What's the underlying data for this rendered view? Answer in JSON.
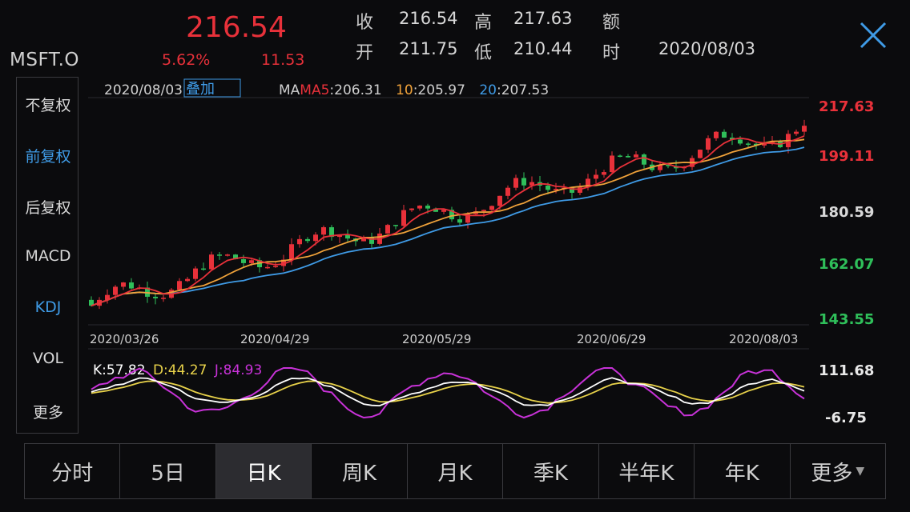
{
  "header": {
    "ticker": "MSFT.O",
    "price": "216.54",
    "change_pct": "5.62%",
    "change": "11.53",
    "quote": [
      {
        "label": "收",
        "value": "216.54"
      },
      {
        "label": "高",
        "value": "217.63"
      },
      {
        "label": "额",
        "value": ""
      },
      {
        "label": "开",
        "value": "211.75"
      },
      {
        "label": "低",
        "value": "210.44"
      },
      {
        "label": "时",
        "value": "2020/08/03"
      }
    ]
  },
  "left_menu": [
    {
      "label": "不复权",
      "active": false
    },
    {
      "label": "前复权",
      "active": true
    },
    {
      "label": "后复权",
      "active": false
    },
    {
      "label": "MACD",
      "active": false
    },
    {
      "label": "KDJ",
      "active": true
    },
    {
      "label": "VOL",
      "active": false
    },
    {
      "label": "更多",
      "active": false
    }
  ],
  "main_chart": {
    "date_label": "2020/08/03",
    "overlay_button": "叠加",
    "ma": [
      {
        "name": "MA5",
        "value": "206.31",
        "color": "#e8313a"
      },
      {
        "name": "10",
        "value": "205.97",
        "color": "#f0a23a"
      },
      {
        "name": "20",
        "value": "207.53",
        "color": "#3f9be6"
      }
    ],
    "y_labels": [
      {
        "text": "217.63",
        "color": "#e8313a"
      },
      {
        "text": "199.11",
        "color": "#e8313a"
      },
      {
        "text": "180.59",
        "color": "#d8d8d8"
      },
      {
        "text": "162.07",
        "color": "#2fbf5a"
      },
      {
        "text": "143.55",
        "color": "#2fbf5a"
      }
    ],
    "x_labels": [
      "2020/03/26",
      "2020/04/29",
      "2020/05/29",
      "2020/06/29",
      "2020/08/03"
    ]
  },
  "kdj": {
    "k_label": "K:57.82",
    "d_label": "D:44.27",
    "j_label": "J:84.93",
    "y_labels": [
      "111.68",
      "-6.75"
    ],
    "colors": {
      "k": "#ffffff",
      "d": "#e8d24a",
      "j": "#c832d8"
    }
  },
  "tabs": [
    {
      "label": "分时",
      "active": false
    },
    {
      "label": "5日",
      "active": false
    },
    {
      "label": "日K",
      "active": true
    },
    {
      "label": "周K",
      "active": false
    },
    {
      "label": "月K",
      "active": false
    },
    {
      "label": "季K",
      "active": false
    },
    {
      "label": "半年K",
      "active": false
    },
    {
      "label": "年K",
      "active": false
    },
    {
      "label": "更多",
      "active": false,
      "dropdown": true
    }
  ],
  "colors": {
    "up": "#e8313a",
    "down": "#2fbf5a",
    "accent": "#3f9be6",
    "background": "#0b0b0d"
  }
}
